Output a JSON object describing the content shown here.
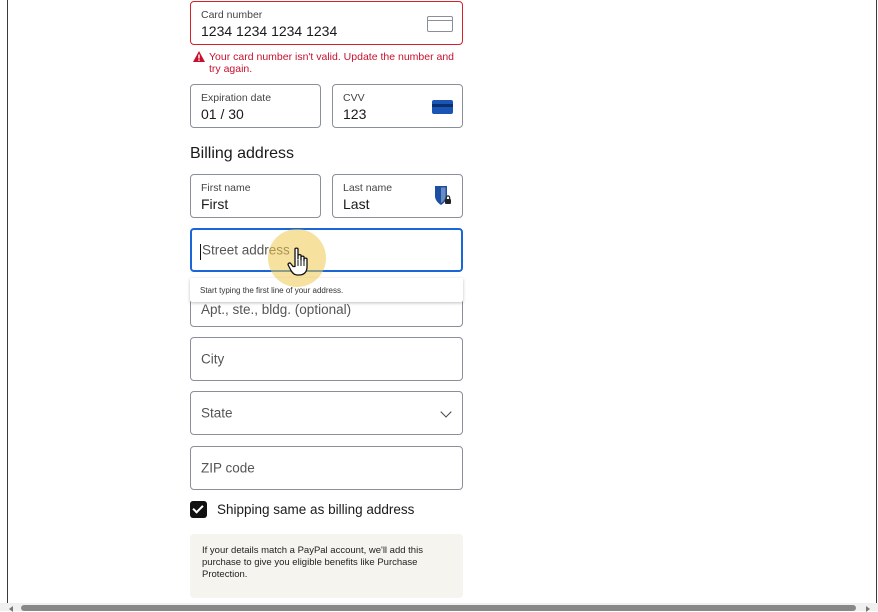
{
  "payment": {
    "card_number": {
      "label": "Card number",
      "value": "1234 1234 1234 1234"
    },
    "card_error": "Your card number isn't valid. Update the number and try again.",
    "expiration": {
      "label": "Expiration date",
      "value": "01 / 30"
    },
    "cvv": {
      "label": "CVV",
      "value": "123"
    }
  },
  "billing": {
    "title": "Billing address",
    "first_name": {
      "label": "First name",
      "value": "First"
    },
    "last_name": {
      "label": "Last name",
      "value": "Last"
    },
    "street": {
      "placeholder": "Street address",
      "hint": "Start typing the first line of your address."
    },
    "apt": {
      "placeholder": "Apt., ste., bldg. (optional)"
    },
    "city": {
      "placeholder": "City"
    },
    "state": {
      "placeholder": "State"
    },
    "zip": {
      "placeholder": "ZIP code"
    }
  },
  "shipping_same": {
    "label": "Shipping same as billing address",
    "checked": true
  },
  "paypal_note": "If your details match a PayPal account, we'll add this purchase to give you eligible benefits like Purchase Protection.",
  "colors": {
    "error": "#d8202a",
    "focus": "#1a66d9",
    "note_bg": "#f6f4ef",
    "cursor_highlight": "#eec850"
  },
  "icons": [
    "card-outline-icon",
    "warning-icon",
    "cvv-card-icon",
    "password-manager-shield-icon",
    "chevron-down-icon",
    "checkmark-icon",
    "hand-pointer-cursor-icon"
  ]
}
